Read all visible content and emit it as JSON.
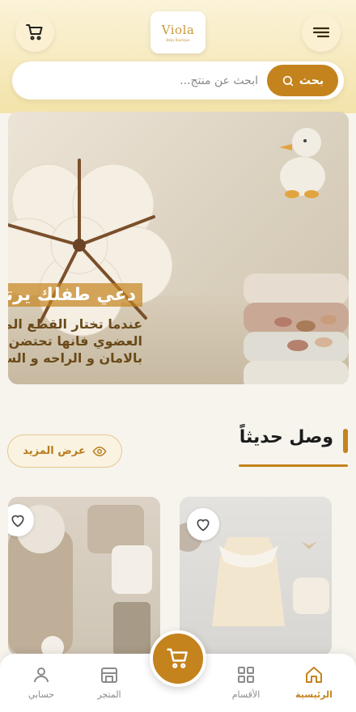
{
  "header": {
    "logo_text": "Viola",
    "logo_sub": "Baby Boutique"
  },
  "search": {
    "placeholder": "ابحث عن منتج...",
    "button_label": "بحث"
  },
  "banner": {
    "title": "دعي طفلك يرتدي",
    "lines": [
      "عندما تختار القطع المصنوعة من القطن",
      "العضوي فانها تحتضن طفلك",
      "بالامان و الراحه و السلام"
    ]
  },
  "section": {
    "title": "وصل حديثاً",
    "more_label": "عرض المزيد"
  },
  "colors": {
    "accent": "#c4831d",
    "header_top": "#fbf3d9",
    "header_bottom": "#f3e3a9"
  },
  "nav": {
    "items": [
      {
        "label": "الرئيسية",
        "icon": "home-icon",
        "active": true
      },
      {
        "label": "الأقسام",
        "icon": "grid-icon",
        "active": false
      },
      {
        "label": "المتجر",
        "icon": "store-icon",
        "active": false
      },
      {
        "label": "حسابي",
        "icon": "user-icon",
        "active": false
      }
    ]
  }
}
